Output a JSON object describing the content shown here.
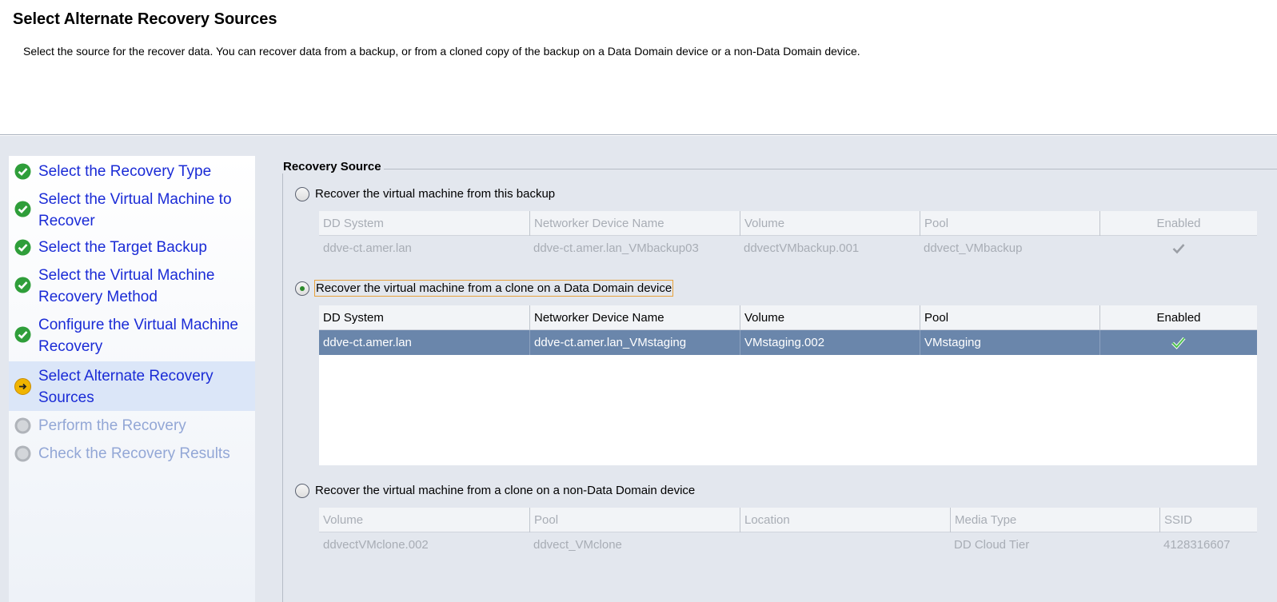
{
  "header": {
    "title": "Select Alternate Recovery Sources",
    "description": "Select the source for the recover data. You can recover data from a backup, or from a cloned copy of the backup on a Data Domain device or a non-Data Domain device."
  },
  "sidebar": {
    "steps": [
      {
        "label": "Select the Recovery Type",
        "status": "complete"
      },
      {
        "label": "Select the Virtual Machine to Recover",
        "status": "complete"
      },
      {
        "label": "Select the Target Backup",
        "status": "complete"
      },
      {
        "label": "Select the Virtual Machine Recovery Method",
        "status": "complete"
      },
      {
        "label": "Configure the Virtual Machine Recovery",
        "status": "complete"
      },
      {
        "label": "Select Alternate Recovery Sources",
        "status": "current"
      },
      {
        "label": "Perform the Recovery",
        "status": "pending"
      },
      {
        "label": "Check the Recovery Results",
        "status": "pending"
      }
    ]
  },
  "recovery_source": {
    "legend": "Recovery Source",
    "options": [
      {
        "label": "Recover the virtual machine from this backup",
        "selected": false,
        "columns": [
          "DD System",
          "Networker Device Name",
          "Volume",
          "Pool",
          "Enabled"
        ],
        "rows": [
          [
            "ddve-ct.amer.lan",
            "ddve-ct.amer.lan_VMbackup03",
            "ddvectVMbackup.001",
            "ddvect_VMbackup",
            "check"
          ]
        ]
      },
      {
        "label": "Recover the virtual machine from a clone on a Data Domain device",
        "selected": true,
        "columns": [
          "DD System",
          "Networker Device Name",
          "Volume",
          "Pool",
          "Enabled"
        ],
        "rows": [
          [
            "ddve-ct.amer.lan",
            "ddve-ct.amer.lan_VMstaging",
            "VMstaging.002",
            "VMstaging",
            "check"
          ]
        ]
      },
      {
        "label": "Recover the virtual machine from a clone on a non-Data Domain device",
        "selected": false,
        "columns": [
          "Volume",
          "Pool",
          "Location",
          "Media Type",
          "SSID"
        ],
        "rows": [
          [
            "ddvectVMclone.002",
            "ddvect_VMclone",
            "",
            "DD Cloud Tier",
            "4128316607"
          ]
        ]
      }
    ]
  },
  "colors": {
    "link": "#1a2bd6",
    "selected_row": "#6a86ab",
    "focus_outline": "#e8a23b",
    "complete_icon": "#2f9e3a",
    "current_icon": "#f0b400"
  }
}
